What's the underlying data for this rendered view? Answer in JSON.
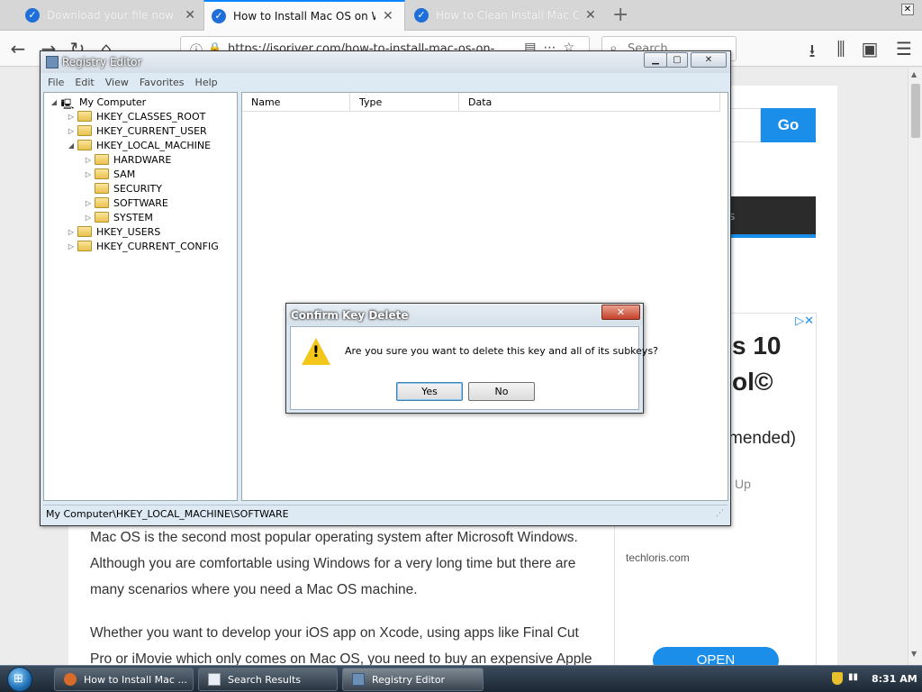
{
  "browser": {
    "tabs": [
      {
        "title": "Download your file now - ISOR",
        "state": "inactive"
      },
      {
        "title": "How to Install Mac OS on Wind",
        "state": "active"
      },
      {
        "title": "How to Clean Install Mac OS u",
        "state": "inactive"
      }
    ],
    "url": "https://isoriver.com/how-to-install-mac-os-on-",
    "search_placeholder": "Search",
    "accent_color": "#0a84ff"
  },
  "page": {
    "go_label": "Go",
    "dark_bar_text": "s",
    "ad": {
      "badge": "▷✕",
      "line1": "s 10",
      "line2": "ol©",
      "line3": "mended)",
      "line4": "Up",
      "site": "techloris.com",
      "open_label": "OPEN"
    },
    "paragraph1": [
      "Mac OS is the second most popular operating system after Microsoft Windows.",
      "Although you are comfortable using Windows for a very long time but there are",
      "many scenarios where you need a Mac OS machine."
    ],
    "paragraph2": [
      "Whether you want to develop your iOS app on Xcode, using apps like Final Cut",
      "Pro or iMovie which only comes on Mac OS, you need to buy an expensive Apple"
    ]
  },
  "registry": {
    "title": "Registry Editor",
    "menu": [
      "File",
      "Edit",
      "View",
      "Favorites",
      "Help"
    ],
    "tree": {
      "root": "My Computer",
      "nodes": [
        {
          "label": "HKEY_CLASSES_ROOT"
        },
        {
          "label": "HKEY_CURRENT_USER"
        },
        {
          "label": "HKEY_LOCAL_MACHINE"
        },
        {
          "label": "HARDWARE"
        },
        {
          "label": "SAM"
        },
        {
          "label": "SECURITY"
        },
        {
          "label": "SOFTWARE"
        },
        {
          "label": "SYSTEM"
        },
        {
          "label": "HKEY_USERS"
        },
        {
          "label": "HKEY_CURRENT_CONFIG"
        }
      ]
    },
    "columns": [
      "Name",
      "Type",
      "Data"
    ],
    "status": "My Computer\\HKEY_LOCAL_MACHINE\\SOFTWARE"
  },
  "dialog": {
    "title": "Confirm Key Delete",
    "message": "Are you sure you want to delete this key and all of its subkeys?",
    "yes_label": "Yes",
    "no_label": "No",
    "icon": "warning-icon"
  },
  "taskbar": {
    "items": [
      {
        "label": "How to Install Mac ...",
        "icon": "firefox-icon"
      },
      {
        "label": "Search Results",
        "icon": "document-icon"
      },
      {
        "label": "Registry Editor",
        "icon": "registry-icon"
      }
    ],
    "clock": "8:31 AM"
  }
}
